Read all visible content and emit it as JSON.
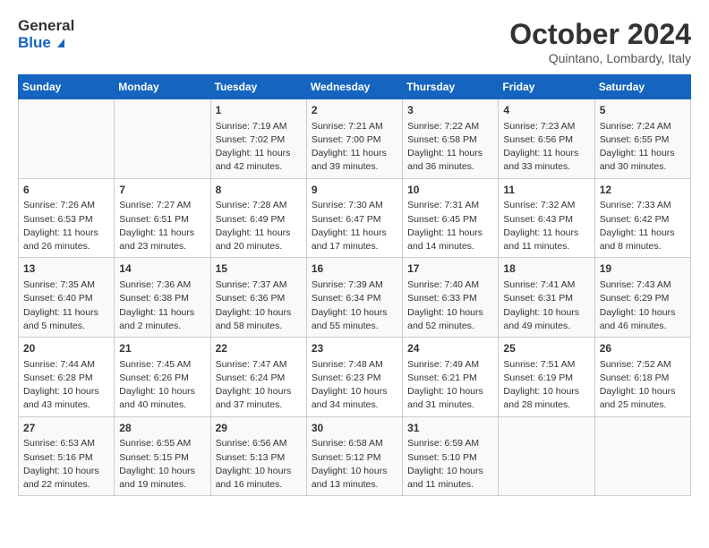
{
  "header": {
    "logo_line1": "General",
    "logo_line2": "Blue",
    "month_title": "October 2024",
    "location": "Quintano, Lombardy, Italy"
  },
  "weekdays": [
    "Sunday",
    "Monday",
    "Tuesday",
    "Wednesday",
    "Thursday",
    "Friday",
    "Saturday"
  ],
  "weeks": [
    [
      {
        "day": "",
        "info": ""
      },
      {
        "day": "",
        "info": ""
      },
      {
        "day": "1",
        "info": "Sunrise: 7:19 AM\nSunset: 7:02 PM\nDaylight: 11 hours and 42 minutes."
      },
      {
        "day": "2",
        "info": "Sunrise: 7:21 AM\nSunset: 7:00 PM\nDaylight: 11 hours and 39 minutes."
      },
      {
        "day": "3",
        "info": "Sunrise: 7:22 AM\nSunset: 6:58 PM\nDaylight: 11 hours and 36 minutes."
      },
      {
        "day": "4",
        "info": "Sunrise: 7:23 AM\nSunset: 6:56 PM\nDaylight: 11 hours and 33 minutes."
      },
      {
        "day": "5",
        "info": "Sunrise: 7:24 AM\nSunset: 6:55 PM\nDaylight: 11 hours and 30 minutes."
      }
    ],
    [
      {
        "day": "6",
        "info": "Sunrise: 7:26 AM\nSunset: 6:53 PM\nDaylight: 11 hours and 26 minutes."
      },
      {
        "day": "7",
        "info": "Sunrise: 7:27 AM\nSunset: 6:51 PM\nDaylight: 11 hours and 23 minutes."
      },
      {
        "day": "8",
        "info": "Sunrise: 7:28 AM\nSunset: 6:49 PM\nDaylight: 11 hours and 20 minutes."
      },
      {
        "day": "9",
        "info": "Sunrise: 7:30 AM\nSunset: 6:47 PM\nDaylight: 11 hours and 17 minutes."
      },
      {
        "day": "10",
        "info": "Sunrise: 7:31 AM\nSunset: 6:45 PM\nDaylight: 11 hours and 14 minutes."
      },
      {
        "day": "11",
        "info": "Sunrise: 7:32 AM\nSunset: 6:43 PM\nDaylight: 11 hours and 11 minutes."
      },
      {
        "day": "12",
        "info": "Sunrise: 7:33 AM\nSunset: 6:42 PM\nDaylight: 11 hours and 8 minutes."
      }
    ],
    [
      {
        "day": "13",
        "info": "Sunrise: 7:35 AM\nSunset: 6:40 PM\nDaylight: 11 hours and 5 minutes."
      },
      {
        "day": "14",
        "info": "Sunrise: 7:36 AM\nSunset: 6:38 PM\nDaylight: 11 hours and 2 minutes."
      },
      {
        "day": "15",
        "info": "Sunrise: 7:37 AM\nSunset: 6:36 PM\nDaylight: 10 hours and 58 minutes."
      },
      {
        "day": "16",
        "info": "Sunrise: 7:39 AM\nSunset: 6:34 PM\nDaylight: 10 hours and 55 minutes."
      },
      {
        "day": "17",
        "info": "Sunrise: 7:40 AM\nSunset: 6:33 PM\nDaylight: 10 hours and 52 minutes."
      },
      {
        "day": "18",
        "info": "Sunrise: 7:41 AM\nSunset: 6:31 PM\nDaylight: 10 hours and 49 minutes."
      },
      {
        "day": "19",
        "info": "Sunrise: 7:43 AM\nSunset: 6:29 PM\nDaylight: 10 hours and 46 minutes."
      }
    ],
    [
      {
        "day": "20",
        "info": "Sunrise: 7:44 AM\nSunset: 6:28 PM\nDaylight: 10 hours and 43 minutes."
      },
      {
        "day": "21",
        "info": "Sunrise: 7:45 AM\nSunset: 6:26 PM\nDaylight: 10 hours and 40 minutes."
      },
      {
        "day": "22",
        "info": "Sunrise: 7:47 AM\nSunset: 6:24 PM\nDaylight: 10 hours and 37 minutes."
      },
      {
        "day": "23",
        "info": "Sunrise: 7:48 AM\nSunset: 6:23 PM\nDaylight: 10 hours and 34 minutes."
      },
      {
        "day": "24",
        "info": "Sunrise: 7:49 AM\nSunset: 6:21 PM\nDaylight: 10 hours and 31 minutes."
      },
      {
        "day": "25",
        "info": "Sunrise: 7:51 AM\nSunset: 6:19 PM\nDaylight: 10 hours and 28 minutes."
      },
      {
        "day": "26",
        "info": "Sunrise: 7:52 AM\nSunset: 6:18 PM\nDaylight: 10 hours and 25 minutes."
      }
    ],
    [
      {
        "day": "27",
        "info": "Sunrise: 6:53 AM\nSunset: 5:16 PM\nDaylight: 10 hours and 22 minutes."
      },
      {
        "day": "28",
        "info": "Sunrise: 6:55 AM\nSunset: 5:15 PM\nDaylight: 10 hours and 19 minutes."
      },
      {
        "day": "29",
        "info": "Sunrise: 6:56 AM\nSunset: 5:13 PM\nDaylight: 10 hours and 16 minutes."
      },
      {
        "day": "30",
        "info": "Sunrise: 6:58 AM\nSunset: 5:12 PM\nDaylight: 10 hours and 13 minutes."
      },
      {
        "day": "31",
        "info": "Sunrise: 6:59 AM\nSunset: 5:10 PM\nDaylight: 10 hours and 11 minutes."
      },
      {
        "day": "",
        "info": ""
      },
      {
        "day": "",
        "info": ""
      }
    ]
  ]
}
